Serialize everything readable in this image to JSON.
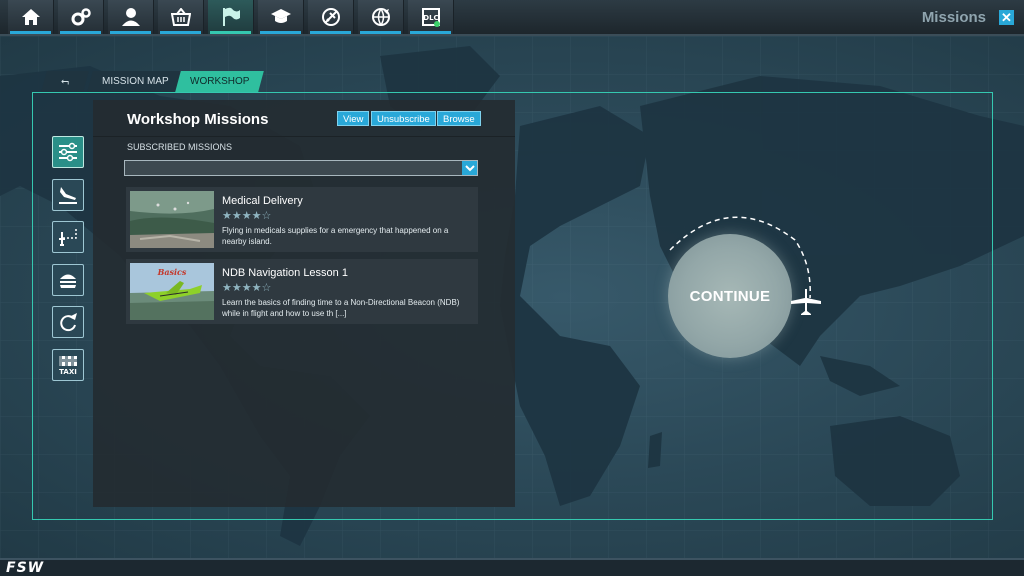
{
  "app": {
    "title": "Missions"
  },
  "nav": {
    "items": [
      {
        "name": "home-icon"
      },
      {
        "name": "settings-icon"
      },
      {
        "name": "pilot-icon"
      },
      {
        "name": "shop-icon"
      },
      {
        "name": "missions-flag-icon"
      },
      {
        "name": "academy-icon"
      },
      {
        "name": "aircraft-icon"
      },
      {
        "name": "multiplayer-icon"
      },
      {
        "name": "dlc-icon"
      }
    ],
    "dlc_label": "DLC"
  },
  "breadcrumb": {
    "back_label": "⮢",
    "items": [
      "MISSION MAP",
      "WORKSHOP"
    ]
  },
  "panel": {
    "title": "Workshop Missions",
    "buttons": {
      "view": "View",
      "unsubscribe": "Unsubscribe",
      "browse": "Browse"
    },
    "subscribed_label": "SUBSCRIBED MISSIONS",
    "select_value": "",
    "missions": [
      {
        "name": "Medical Delivery",
        "stars": "★★★★☆",
        "rating": 4,
        "description": "Flying in medicals supplies for a emergency that happened on a nearby island."
      },
      {
        "name": "NDB Navigation Lesson 1",
        "stars": "★★★★☆",
        "rating": 4,
        "thumb_text": "Basics",
        "description": "Learn the basics of finding time to a Non-Directional Beacon (NDB) while in flight and how to use th [...]"
      }
    ]
  },
  "tools": [
    {
      "name": "filters-icon"
    },
    {
      "name": "landing-icon"
    },
    {
      "name": "route-icon"
    },
    {
      "name": "food-delivery-icon"
    },
    {
      "name": "aerobatics-icon"
    },
    {
      "name": "taxi-icon"
    }
  ],
  "taxi_label": "TAXI",
  "continue_label": "CONTINUE",
  "footer": {
    "logo": "FSW"
  },
  "colors": {
    "accent": "#29a8d8",
    "active": "#35c8b0",
    "panel": "#242c32"
  }
}
